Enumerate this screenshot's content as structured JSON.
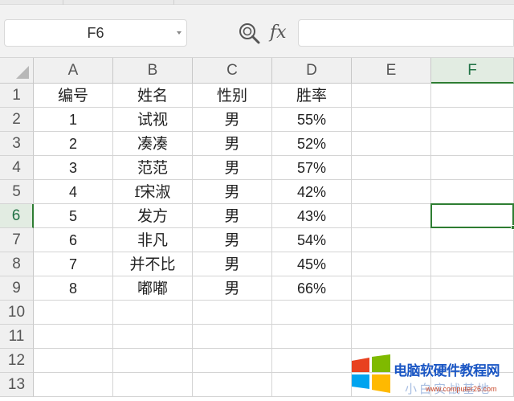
{
  "name_box": {
    "value": "F6"
  },
  "formula_bar": {
    "fx_label": "fx",
    "value": ""
  },
  "columns": [
    "A",
    "B",
    "C",
    "D",
    "E",
    "F"
  ],
  "rows": [
    "1",
    "2",
    "3",
    "4",
    "5",
    "6",
    "7",
    "8",
    "9",
    "10",
    "11",
    "12",
    "13"
  ],
  "active_cell": {
    "column": "F",
    "row": "6"
  },
  "sheet": {
    "headers": [
      "编号",
      "姓名",
      "性别",
      "胜率"
    ],
    "records": [
      [
        "1",
        "试视",
        "男",
        "55%"
      ],
      [
        "2",
        "凑凑",
        "男",
        "52%"
      ],
      [
        "3",
        "范范",
        "男",
        "57%"
      ],
      [
        "4",
        "f宋淑",
        "男",
        "42%"
      ],
      [
        "5",
        "发方",
        "男",
        "43%"
      ],
      [
        "6",
        "非凡",
        "男",
        "54%"
      ],
      [
        "7",
        "并不比",
        "男",
        "45%"
      ],
      [
        "8",
        "嘟嘟",
        "男",
        "66%"
      ]
    ]
  },
  "watermark": {
    "line1": "电脑软硬件教程网",
    "line2": "小白实战基地",
    "line3": "www.computer26.com"
  },
  "colors": {
    "accent": "#2e7d32",
    "header_bg": "#f0f0f0",
    "grid_line": "#d4d4d4"
  }
}
